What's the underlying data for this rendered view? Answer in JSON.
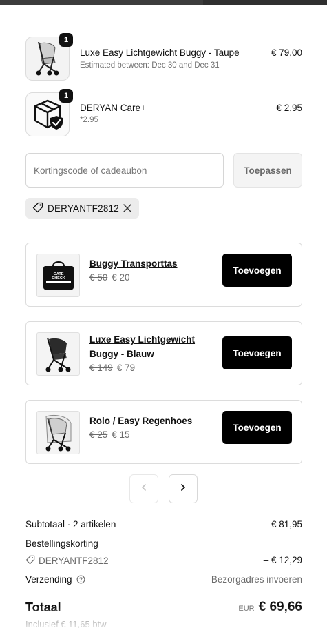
{
  "cart": {
    "items": [
      {
        "name": "Luxe Easy Lichtgewicht Buggy - Taupe",
        "sub": "Estimated between: Dec 30 and Dec 31",
        "price": "€ 79,00",
        "qty": "1",
        "icon": "stroller-image"
      },
      {
        "name": "DERYAN Care+",
        "sub": "*2.95",
        "price": "€ 2,95",
        "qty": "1",
        "icon": "shield-box-icon"
      }
    ]
  },
  "discount": {
    "placeholder": "Kortingscode of cadeaubon",
    "apply_label": "Toepassen",
    "applied_code": "DERYANTF2812",
    "tag_icon": "tag-icon",
    "remove_icon": "close-icon"
  },
  "upsells": [
    {
      "title": "Buggy Transporttas",
      "old_price": "€ 50",
      "new_price": "€ 20",
      "button": "Toevoegen",
      "image": "bag-image",
      "bag_text": "GATE CHECK"
    },
    {
      "title": "Luxe Easy Lichtgewicht Buggy - Blauw",
      "old_price": "€ 149",
      "new_price": "€ 79",
      "button": "Toevoegen",
      "image": "stroller-image"
    },
    {
      "title": "Rolo / Easy Regenhoes",
      "old_price": "€ 25",
      "new_price": "€ 15",
      "button": "Toevoegen",
      "image": "raincover-stroller-image"
    }
  ],
  "pager": {
    "prev_icon": "chevron-left-icon",
    "next_icon": "chevron-right-icon"
  },
  "summary": {
    "subtotal_label": "Subtotaal · 2 artikelen",
    "subtotal_value": "€ 81,95",
    "discount_label": "Bestellingskorting",
    "discount_code": "DERYANTF2812",
    "discount_value": "– € 12,29",
    "shipping_label": "Verzending",
    "shipping_value": "Bezorgadres invoeren",
    "total_label": "Totaal",
    "currency": "EUR",
    "total_value": "€ 69,66",
    "tax_note": "Inclusief € 11,65 btw"
  },
  "colors": {
    "primary_button": "#000000",
    "muted_text": "#6b6b6b",
    "border": "#dcdcdc"
  }
}
